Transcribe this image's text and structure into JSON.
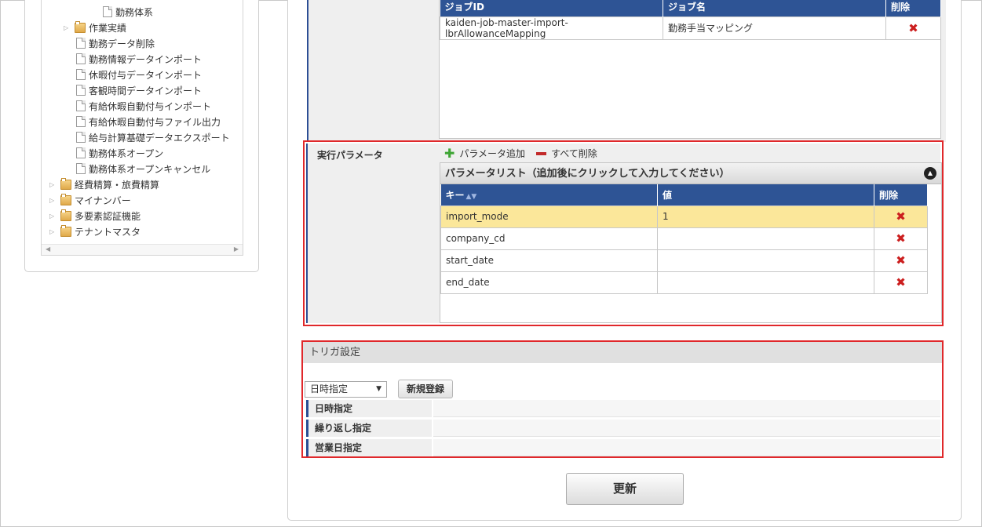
{
  "tree": {
    "items": [
      {
        "label": "勤務体系",
        "kind": "doc",
        "indent": 2,
        "expander": false
      },
      {
        "label": "作業実績",
        "kind": "folder",
        "indent": 1,
        "expander": true
      },
      {
        "label": "勤務データ削除",
        "kind": "doc",
        "indent": 1,
        "expander": false
      },
      {
        "label": "勤務情報データインポート",
        "kind": "doc",
        "indent": 1,
        "expander": false
      },
      {
        "label": "休暇付与データインポート",
        "kind": "doc",
        "indent": 1,
        "expander": false
      },
      {
        "label": "客観時間データインポート",
        "kind": "doc",
        "indent": 1,
        "expander": false
      },
      {
        "label": "有給休暇自動付与インポート",
        "kind": "doc",
        "indent": 1,
        "expander": false
      },
      {
        "label": "有給休暇自動付与ファイル出力",
        "kind": "doc",
        "indent": 1,
        "expander": false
      },
      {
        "label": "給与計算基礎データエクスポート",
        "kind": "doc",
        "indent": 1,
        "expander": false
      },
      {
        "label": "勤務体系オープン",
        "kind": "doc",
        "indent": 1,
        "expander": false
      },
      {
        "label": "勤務体系オープンキャンセル",
        "kind": "doc",
        "indent": 1,
        "expander": false
      },
      {
        "label": "経費精算・旅費精算",
        "kind": "folder",
        "indent": 0,
        "expander": true
      },
      {
        "label": "マイナンバー",
        "kind": "folder",
        "indent": 0,
        "expander": true
      },
      {
        "label": "多要素認証機能",
        "kind": "folder",
        "indent": 0,
        "expander": true
      },
      {
        "label": "テナントマスタ",
        "kind": "folder",
        "indent": 0,
        "expander": true
      }
    ]
  },
  "job_table": {
    "headers": {
      "job_id": "ジョブID",
      "job_name": "ジョブ名",
      "delete": "削除"
    },
    "rows": [
      {
        "job_id": "kaiden-job-master-import-lbrAllowanceMapping",
        "job_name": "勤務手当マッピング",
        "delete_icon": "delete-x-icon"
      }
    ]
  },
  "params": {
    "label": "実行パラメータ",
    "add_label": "パラメータ追加",
    "delete_all_label": "すべて削除",
    "list_title": "パラメータリスト（追加後にクリックして入力してください）",
    "headers": {
      "key": "キー",
      "value": "値",
      "delete": "削除"
    },
    "rows": [
      {
        "key": "import_mode",
        "value": "1",
        "highlighted": true
      },
      {
        "key": "company_cd",
        "value": "",
        "highlighted": false
      },
      {
        "key": "start_date",
        "value": "",
        "highlighted": false
      },
      {
        "key": "end_date",
        "value": "",
        "highlighted": false
      }
    ]
  },
  "trigger": {
    "title": "トリガ設定",
    "select_value": "日時指定",
    "new_button": "新規登録",
    "rows": [
      "日時指定",
      "繰り返し指定",
      "営業日指定"
    ]
  },
  "update_button": "更新",
  "colors": {
    "header_blue": "#2e5495",
    "highlight": "#e0282b",
    "row_highlight": "#fbe79a",
    "delete_red": "#cc1f1f"
  }
}
